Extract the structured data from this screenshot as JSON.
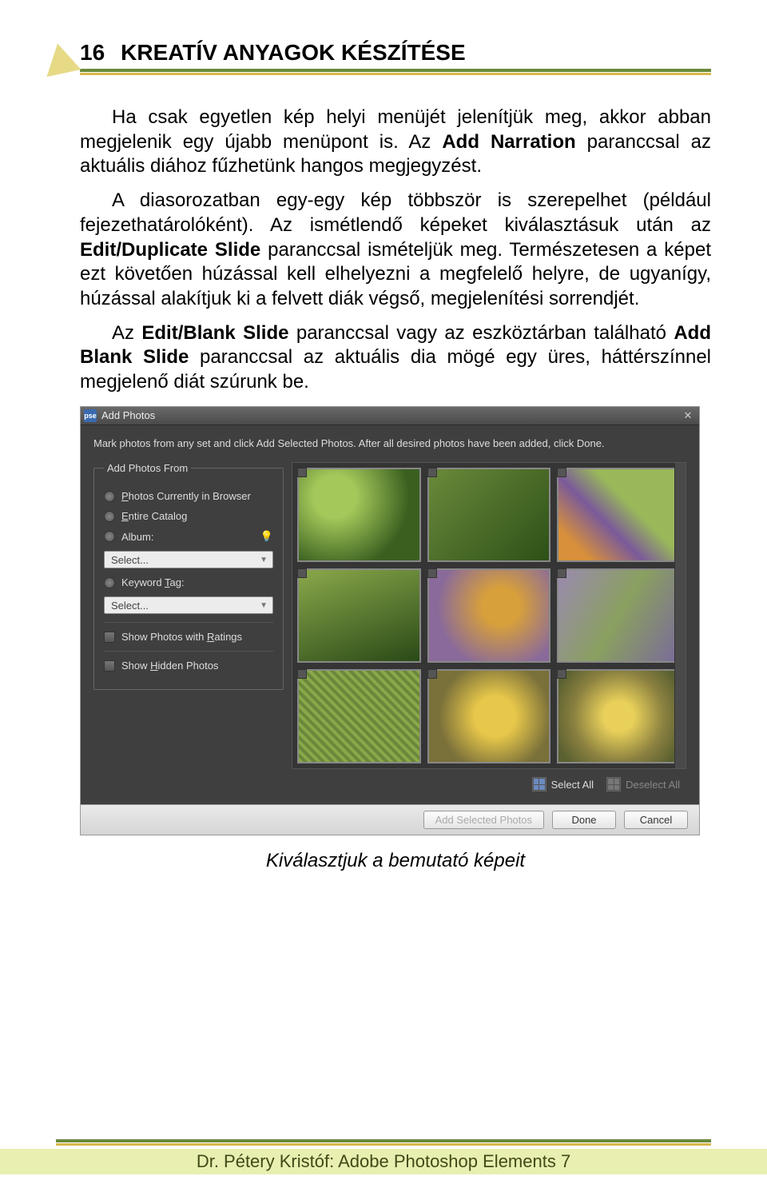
{
  "page_number": "16",
  "header_title": "KREATÍV ANYAGOK KÉSZÍTÉSE",
  "paragraphs": {
    "p1": "Ha csak egyetlen kép helyi menüjét jelenítjük meg, akkor abban megjelenik egy újabb menüpont is. Az ",
    "p1b": "Add Narration",
    "p1c": " paranccsal az aktuális diához fűzhetünk hangos megjegyzést.",
    "p2a": "A diasorozatban egy-egy kép többször is szerepelhet (például fejezethatárolóként). Az ismétlendő képeket kiválasztásuk után az ",
    "p2b": "Edit/Duplicate Slide",
    "p2c": " paranccsal ismételjük meg. Természetesen a képet ezt követően húzással kell elhelyezni a megfelelő helyre, de ugyanígy, húzással alakítjuk ki a felvett diák végső, megjelenítési sorrendjét.",
    "p3a": "Az ",
    "p3b": "Edit/Blank Slide",
    "p3c": " paranccsal vagy az eszköztárban található ",
    "p3d": "Add Blank Slide",
    "p3e": " paranccsal az aktuális dia mögé egy üres, háttérszínnel megjelenő diát szúrunk be."
  },
  "dialog": {
    "app_icon": "pse",
    "title": "Add Photos",
    "instructions": "Mark photos from any set and click Add Selected Photos. After all desired photos have been added, click Done.",
    "legend": "Add Photos From",
    "radio_browser_prefix": "P",
    "radio_browser_rest": "hotos Currently in Browser",
    "radio_catalog_prefix": "E",
    "radio_catalog_rest": "ntire Catalog",
    "radio_album": "Album:",
    "select_placeholder": "Select...",
    "radio_keyword_pre": "Keyword ",
    "radio_keyword_u": "T",
    "radio_keyword_post": "ag:",
    "chk_ratings_pre": "Show Photos with ",
    "chk_ratings_u": "R",
    "chk_ratings_post": "atings",
    "chk_hidden_pre": "Show ",
    "chk_hidden_u": "H",
    "chk_hidden_post": "idden Photos",
    "select_all": "Select All",
    "deselect_all": "Deselect All",
    "btn_add": "Add Selected Photos",
    "btn_done": "Done",
    "btn_cancel": "Cancel"
  },
  "caption": "Kiválasztjuk a bemutató képeit",
  "footer": "Dr. Pétery Kristóf: Adobe Photoshop Elements 7"
}
